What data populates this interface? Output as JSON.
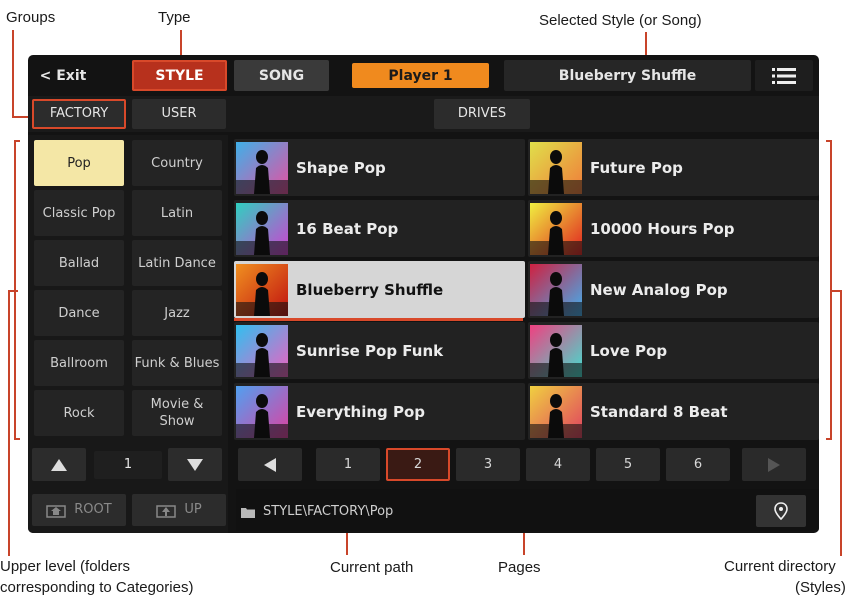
{
  "callouts": {
    "groups": "Groups",
    "type": "Type",
    "selected_style": "Selected Style (or Song)",
    "upper_level_line1": "Upper level (folders",
    "upper_level_line2": "corresponding to Categories)",
    "current_path": "Current path",
    "pages": "Pages",
    "current_directory_line1": "Current directory",
    "current_directory_line2": "(Styles)"
  },
  "header": {
    "exit_label": "< Exit",
    "style_tab": "STYLE",
    "song_tab": "SONG",
    "player_label": "Player 1",
    "selected_name": "Blueberry Shuffle",
    "menu_icon": "hamburger-menu-icon"
  },
  "groups_bar": {
    "factory": "FACTORY",
    "user": "USER",
    "drives": "DRIVES"
  },
  "categories": [
    {
      "label": "Pop",
      "selected": true
    },
    {
      "label": "Country",
      "selected": false
    },
    {
      "label": "Classic Pop",
      "selected": false
    },
    {
      "label": "Latin",
      "selected": false
    },
    {
      "label": "Ballad",
      "selected": false
    },
    {
      "label": "Latin Dance",
      "selected": false
    },
    {
      "label": "Dance",
      "selected": false
    },
    {
      "label": "Jazz",
      "selected": false
    },
    {
      "label": "Ballroom",
      "selected": false
    },
    {
      "label": "Funk & Blues",
      "selected": false
    },
    {
      "label": "Rock",
      "selected": false
    },
    {
      "label": "Movie & Show",
      "selected": false
    }
  ],
  "category_nav": {
    "page_number": "1",
    "up_icon": "triangle-up-icon",
    "down_icon": "triangle-down-icon",
    "root_label": "ROOT",
    "up_label": "UP"
  },
  "styles": [
    {
      "name": "Shape Pop",
      "selected": false
    },
    {
      "name": "Future Pop",
      "selected": false
    },
    {
      "name": "16 Beat Pop",
      "selected": false
    },
    {
      "name": "10000 Hours Pop",
      "selected": false
    },
    {
      "name": "Blueberry Shuffle",
      "selected": true
    },
    {
      "name": "New Analog Pop",
      "selected": false
    },
    {
      "name": "Sunrise Pop Funk",
      "selected": false
    },
    {
      "name": "Love Pop",
      "selected": false
    },
    {
      "name": "Everything Pop",
      "selected": false
    },
    {
      "name": "Standard 8 Beat",
      "selected": false
    }
  ],
  "pagination": {
    "pages": [
      "1",
      "2",
      "3",
      "4",
      "5",
      "6"
    ],
    "current": "2",
    "prev_icon": "triangle-left-icon",
    "next_icon": "triangle-right-icon"
  },
  "path": {
    "text": "STYLE\\FACTORY\\Pop",
    "folder_icon": "folder-icon",
    "locate_icon": "location-pin-icon"
  },
  "colors": {
    "accent": "#d8492a",
    "player": "#f08a1e",
    "category_selected": "#f4e7a6",
    "style_selected": "#d6d6d6"
  }
}
